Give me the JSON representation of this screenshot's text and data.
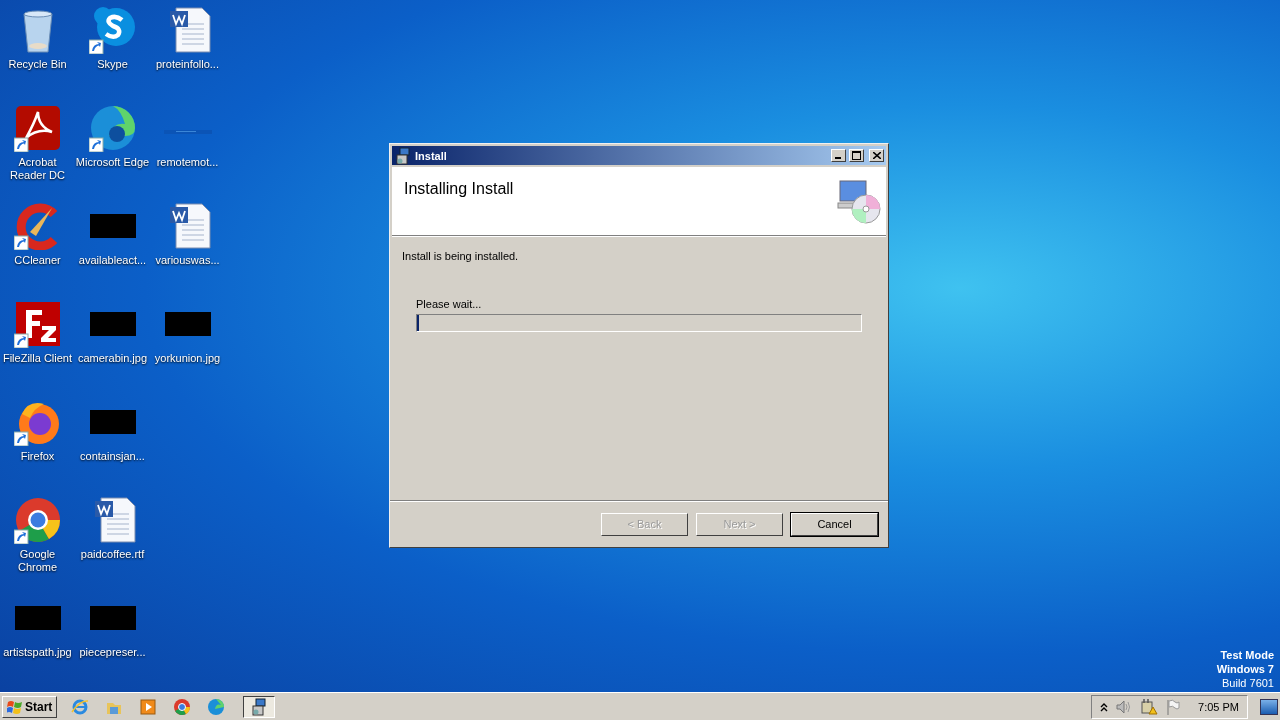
{
  "desktop": {
    "icon_rows": [
      [
        {
          "kind": "recycle",
          "label": "Recycle Bin",
          "shortcut": false
        },
        {
          "kind": "skype",
          "label": "Skype",
          "shortcut": true
        },
        {
          "kind": "word",
          "label": "proteinfollo...",
          "shortcut": false
        }
      ],
      [
        {
          "kind": "acrobat",
          "label": "Acrobat Reader DC",
          "shortcut": true
        },
        {
          "kind": "edge",
          "label": "Microsoft Edge",
          "shortcut": true
        },
        {
          "kind": "strip",
          "label": "remotemot...",
          "shortcut": false
        }
      ],
      [
        {
          "kind": "ccleaner",
          "label": "CCleaner",
          "shortcut": true
        },
        {
          "kind": "thumb",
          "label": "availableact...",
          "shortcut": false
        },
        {
          "kind": "word",
          "label": "variouswas...",
          "shortcut": false
        }
      ],
      [
        {
          "kind": "filezilla",
          "label": "FileZilla Client",
          "shortcut": true
        },
        {
          "kind": "thumb",
          "label": "camerabin.jpg",
          "shortcut": false
        },
        {
          "kind": "thumb",
          "label": "yorkunion.jpg",
          "shortcut": false
        }
      ],
      [
        {
          "kind": "firefox",
          "label": "Firefox",
          "shortcut": true
        },
        {
          "kind": "thumb",
          "label": "containsjan...",
          "shortcut": false
        }
      ],
      [
        {
          "kind": "chrome",
          "label": "Google Chrome",
          "shortcut": true
        },
        {
          "kind": "word",
          "label": "paidcoffee.rtf",
          "shortcut": false
        }
      ],
      [
        {
          "kind": "thumb",
          "label": "artistspath.jpg",
          "shortcut": false
        },
        {
          "kind": "thumb",
          "label": "piecepreser...",
          "shortcut": false
        }
      ]
    ]
  },
  "window": {
    "title": "Install",
    "heading": "Installing Install",
    "message": "Install is being installed.",
    "progress_label": "Please wait...",
    "progress": {
      "level": 0.004
    },
    "buttons": [
      {
        "label": "< Back",
        "disabled": true,
        "default": false
      },
      {
        "label": "Next >",
        "disabled": true,
        "default": false
      },
      {
        "label": "Cancel",
        "disabled": false,
        "default": true
      }
    ]
  },
  "watermark_text": [
    "Test Mode",
    "Windows 7",
    "Build 7601"
  ],
  "taskbar": {
    "start": "Start",
    "quick_launch": [
      {
        "kind": "ie"
      },
      {
        "kind": "folder"
      },
      {
        "kind": "media"
      },
      {
        "kind": "chrome"
      },
      {
        "kind": "edge"
      }
    ],
    "tasks": [
      {
        "kind": "installer",
        "selected": true
      }
    ],
    "clock": "7:05 PM"
  }
}
